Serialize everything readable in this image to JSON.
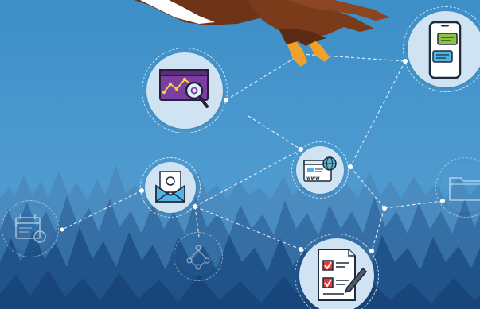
{
  "colors": {
    "sky_top": "#3c8fc7",
    "sky_bottom": "#2b6fa7",
    "forest_back": "#3f84b8",
    "forest_front": "#1d4f84",
    "node_disc": "#cfe3f2",
    "eagle_brown": "#7a3b1a",
    "eagle_talon": "#f0a12b"
  },
  "nodes": [
    {
      "icon": "analytics-magnifier-icon"
    },
    {
      "icon": "mobile-chat-icon"
    },
    {
      "icon": "email-envelope-icon"
    },
    {
      "icon": "website-globe-icon"
    },
    {
      "icon": "checklist-document-icon"
    },
    {
      "icon": "calendar-clock-icon"
    },
    {
      "icon": "folder-icon"
    },
    {
      "icon": "network-molecule-icon"
    }
  ],
  "illustration": {
    "subject": "bald-eagle-icon"
  }
}
